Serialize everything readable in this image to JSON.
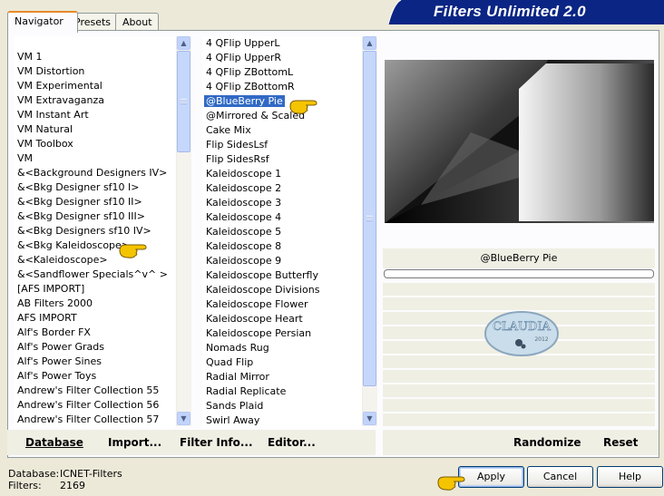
{
  "window": {
    "title": "Filters Unlimited 2.0"
  },
  "tabs": [
    {
      "label": "Navigator",
      "active": true
    },
    {
      "label": "Presets",
      "active": false
    },
    {
      "label": "About",
      "active": false
    }
  ],
  "categories": [
    "VM 1",
    "VM Distortion",
    "VM Experimental",
    "VM Extravaganza",
    "VM Instant Art",
    "VM Natural",
    "VM Toolbox",
    "VM",
    "&<Background Designers IV>",
    "&<Bkg Designer sf10 I>",
    "&<Bkg Designer sf10 II>",
    "&<Bkg Designer sf10 III>",
    "&<Bkg Designers sf10 IV>",
    "&<Bkg Kaleidoscope>",
    "&<Kaleidoscope>",
    "&<Sandflower Specials^v^ >",
    "[AFS IMPORT]",
    "AB Filters 2000",
    "AFS IMPORT",
    "Alf's Border FX",
    "Alf's Power Grads",
    "Alf's Power Sines",
    "Alf's Power Toys",
    "Andrew's Filter Collection 55",
    "Andrew's Filter Collection 56",
    "Andrew's Filter Collection 57"
  ],
  "filters": [
    "4 QFlip UpperL",
    "4 QFlip UpperR",
    "4 QFlip ZBottomL",
    "4 QFlip ZBottomR",
    "@BlueBerry Pie",
    "@Mirrored & Scaled",
    "Cake Mix",
    "Flip SidesLsf",
    "Flip SidesRsf",
    "Kaleidoscope 1",
    "Kaleidoscope 2",
    "Kaleidoscope 3",
    "Kaleidoscope 4",
    "Kaleidoscope 5",
    "Kaleidoscope 8",
    "Kaleidoscope 9",
    "Kaleidoscope Butterfly",
    "Kaleidoscope Divisions",
    "Kaleidoscope Flower",
    "Kaleidoscope Heart",
    "Kaleidoscope Persian",
    "Nomads Rug",
    "Quad Flip",
    "Radial Mirror",
    "Radial Replicate",
    "Sands Plaid",
    "Swirl Away"
  ],
  "selected_filter": "@BlueBerry Pie",
  "preview": {
    "filter_name": "@BlueBerry Pie",
    "watermark": "CLAUDIA",
    "watermark_year": "2012"
  },
  "buttons": {
    "database": "Database",
    "import": "Import...",
    "filter_info": "Filter Info...",
    "editor": "Editor...",
    "randomize": "Randomize",
    "reset": "Reset",
    "apply": "Apply",
    "cancel": "Cancel",
    "help": "Help"
  },
  "status": {
    "database_label": "Database:",
    "database_value": "ICNET-Filters",
    "filters_label": "Filters:",
    "filters_value": "2169"
  },
  "colors": {
    "title_bg": "#0A2584",
    "selection": "#316AC5",
    "hand": "#F5C400"
  }
}
